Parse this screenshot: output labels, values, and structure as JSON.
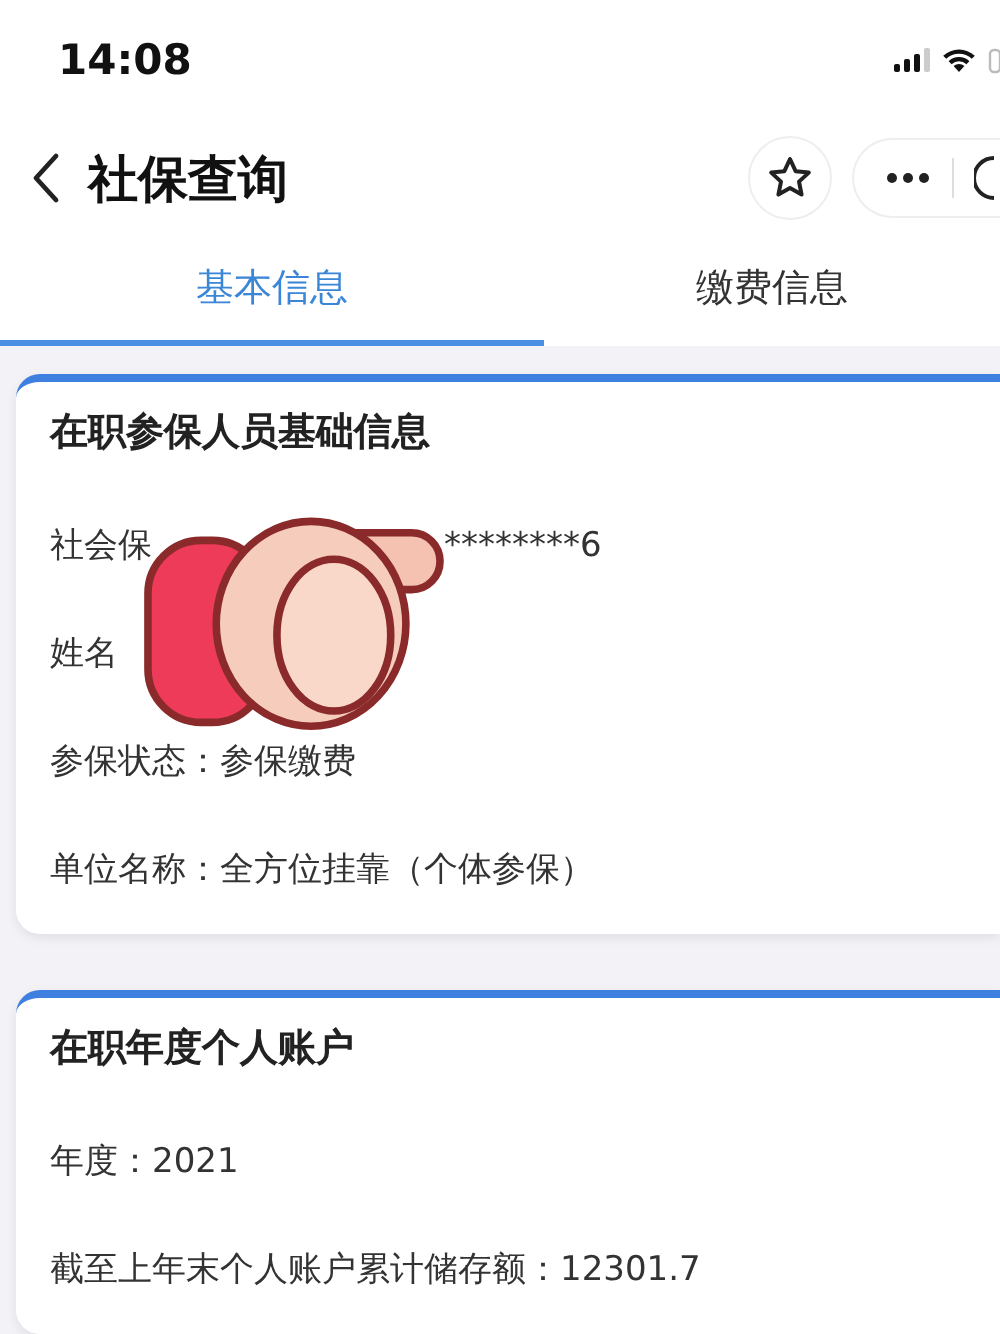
{
  "status_bar": {
    "time": "14:08"
  },
  "nav": {
    "title": "社保查询"
  },
  "tabs": [
    {
      "label": "基本信息",
      "selected": true
    },
    {
      "label": "缴费信息",
      "selected": false
    }
  ],
  "cards": [
    {
      "title": "在职参保人员基础信息",
      "sticker": true,
      "rows": [
        {
          "texts": [
            "社会保",
            "********6"
          ]
        },
        {
          "texts": [
            "姓名"
          ]
        },
        {
          "texts": [
            "参保状态：参保缴费"
          ]
        },
        {
          "texts": [
            "单位名称：全方位挂靠（个体参保）"
          ]
        }
      ]
    },
    {
      "title": "在职年度个人账户",
      "sticker": false,
      "rows": [
        {
          "texts": [
            "年度：2021"
          ]
        },
        {
          "texts": [
            "截至上年末个人账户累计储存额：12301.7"
          ]
        }
      ]
    }
  ]
}
